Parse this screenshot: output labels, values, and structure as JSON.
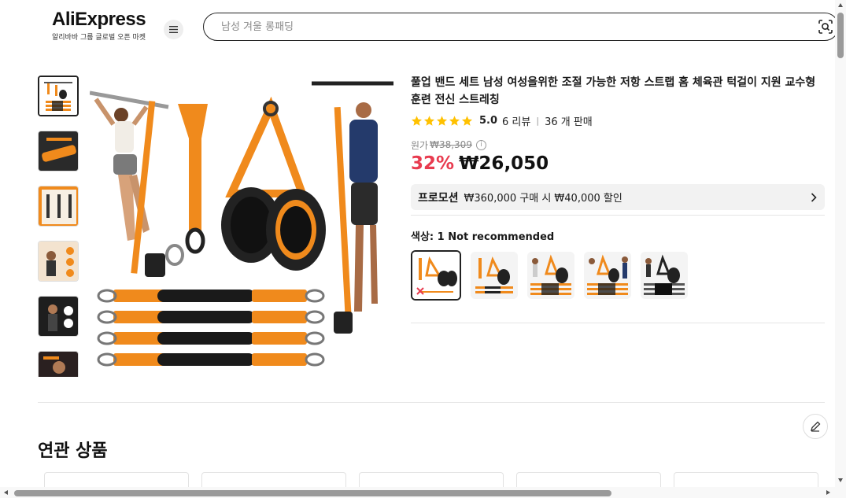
{
  "header": {
    "logo_text": "AliExpress",
    "logo_subtitle": "알리바바 그룹 글로벌 오픈 마켓",
    "search_placeholder": "남성 겨울 롱패딩",
    "menu_icon": "hamburger-icon",
    "camera_icon": "image-search-icon"
  },
  "product": {
    "title": "풀업 밴드 세트 남성 여성을위한 조절 가능한 저항 스트랩 홈 체육관 턱걸이 지원 교수형 훈련 전신 스트레칭",
    "rating": {
      "stars": 5,
      "score": "5.0",
      "reviews": "6 리뷰",
      "sold": "36 개 판매"
    },
    "original_price_label": "원가",
    "original_price": "₩38,309",
    "discount": "32%",
    "price": "₩26,050",
    "promotion": {
      "title": "프로모션",
      "text": "₩360,000 구매 시 ₩40,000 할인"
    },
    "color": {
      "label": "색상: 1 Not recommended",
      "options": [
        "variant-1",
        "variant-2",
        "variant-3",
        "variant-4",
        "variant-5"
      ],
      "selected_index": 0
    },
    "thumbnail_count": 6
  },
  "related": {
    "title": "연관 상품"
  },
  "colors": {
    "brand_orange": "#f08a1c",
    "discount_red": "#e83b4f",
    "star_yellow": "#ffc100"
  }
}
